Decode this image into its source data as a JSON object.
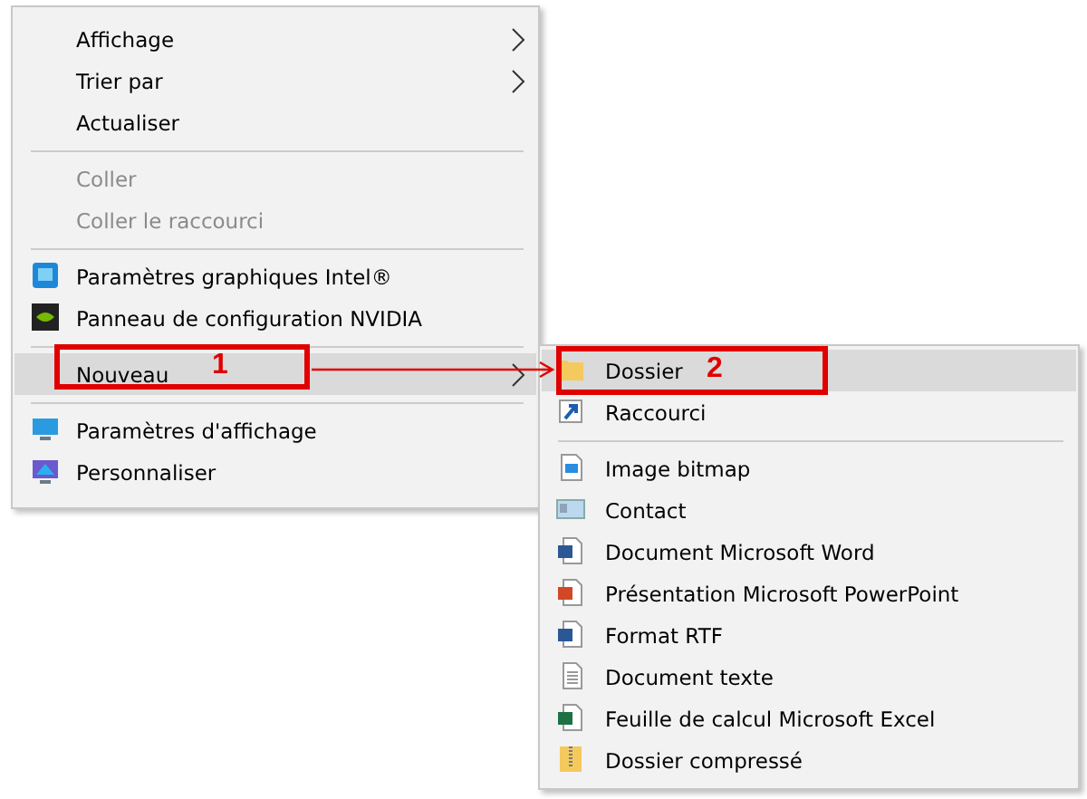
{
  "context_menu": {
    "items": [
      {
        "kind": "item",
        "label": "Affichage",
        "disabled": false,
        "submenu": true,
        "selected": false
      },
      {
        "kind": "item",
        "label": "Trier par",
        "disabled": false,
        "submenu": true,
        "selected": false
      },
      {
        "kind": "item",
        "label": "Actualiser",
        "disabled": false,
        "submenu": false,
        "selected": false
      },
      {
        "kind": "separator"
      },
      {
        "kind": "item",
        "label": "Coller",
        "disabled": true,
        "submenu": false,
        "selected": false
      },
      {
        "kind": "item",
        "label": "Coller le raccourci",
        "disabled": true,
        "submenu": false,
        "selected": false
      },
      {
        "kind": "separator"
      },
      {
        "kind": "item",
        "label": "Paramètres graphiques Intel®",
        "disabled": false,
        "submenu": false,
        "selected": false
      },
      {
        "kind": "item",
        "label": "Panneau de configuration NVIDIA",
        "disabled": false,
        "submenu": false,
        "selected": false
      },
      {
        "kind": "separator"
      },
      {
        "kind": "item",
        "label": "Nouveau",
        "disabled": false,
        "submenu": true,
        "selected": true
      },
      {
        "kind": "separator"
      },
      {
        "kind": "item",
        "label": "Paramètres d'affichage",
        "disabled": false,
        "submenu": false,
        "selected": false
      },
      {
        "kind": "item",
        "label": "Personnaliser",
        "disabled": false,
        "submenu": false,
        "selected": false
      }
    ]
  },
  "submenu": {
    "items": [
      {
        "kind": "item",
        "label": "Dossier",
        "selected": true
      },
      {
        "kind": "item",
        "label": "Raccourci",
        "selected": false
      },
      {
        "kind": "separator"
      },
      {
        "kind": "item",
        "label": "Image bitmap",
        "selected": false
      },
      {
        "kind": "item",
        "label": "Contact",
        "selected": false
      },
      {
        "kind": "item",
        "label": "Document Microsoft Word",
        "selected": false
      },
      {
        "kind": "item",
        "label": "Présentation Microsoft PowerPoint",
        "selected": false
      },
      {
        "kind": "item",
        "label": "Format RTF",
        "selected": false
      },
      {
        "kind": "item",
        "label": "Document texte",
        "selected": false
      },
      {
        "kind": "item",
        "label": "Feuille de calcul Microsoft Excel",
        "selected": false
      },
      {
        "kind": "item",
        "label": "Dossier compressé",
        "selected": false
      }
    ]
  },
  "callouts": [
    {
      "label": "1"
    },
    {
      "label": "2"
    }
  ]
}
